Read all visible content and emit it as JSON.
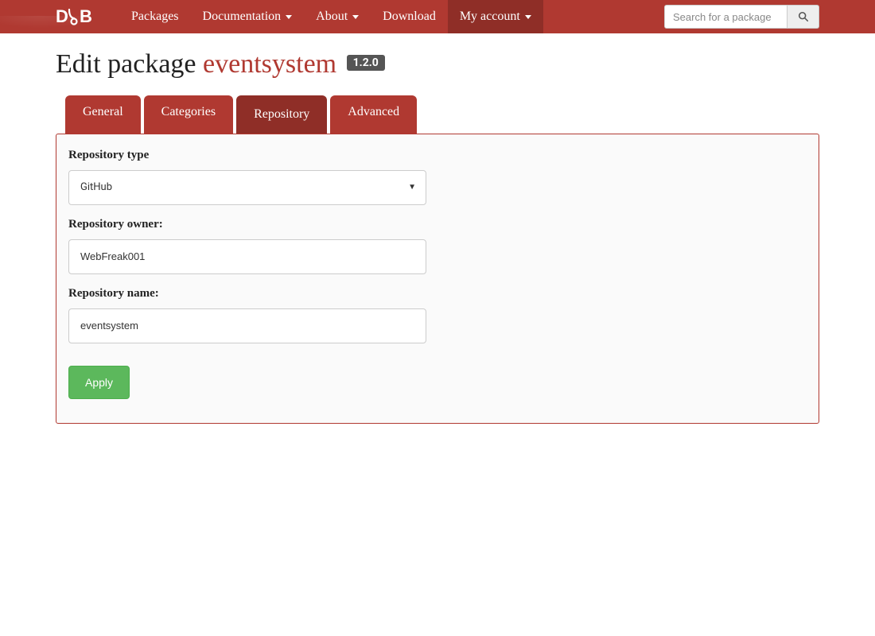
{
  "nav": {
    "packages": "Packages",
    "documentation": "Documentation",
    "about": "About",
    "download": "Download",
    "my_account": "My account"
  },
  "search": {
    "placeholder": "Search for a package"
  },
  "page": {
    "title_prefix": "Edit package ",
    "package_name": "eventsystem",
    "version": "1.2.0"
  },
  "tabs": {
    "general": "General",
    "categories": "Categories",
    "repository": "Repository",
    "advanced": "Advanced"
  },
  "form": {
    "repo_type_label": "Repository type",
    "repo_type_value": "GitHub",
    "repo_owner_label": "Repository owner:",
    "repo_owner_value": "WebFreak001",
    "repo_name_label": "Repository name:",
    "repo_name_value": "eventsystem",
    "apply": "Apply"
  }
}
